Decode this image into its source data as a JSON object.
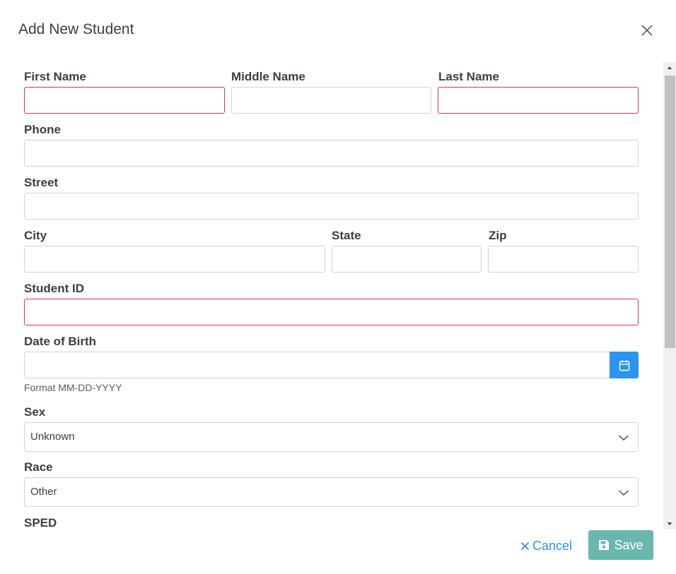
{
  "modal": {
    "title": "Add New Student",
    "close_icon": "close-icon"
  },
  "form": {
    "first_name": {
      "label": "First Name",
      "value": "",
      "invalid": true
    },
    "middle_name": {
      "label": "Middle Name",
      "value": ""
    },
    "last_name": {
      "label": "Last Name",
      "value": "",
      "invalid": true
    },
    "phone": {
      "label": "Phone",
      "value": ""
    },
    "street": {
      "label": "Street",
      "value": ""
    },
    "city": {
      "label": "City",
      "value": ""
    },
    "state": {
      "label": "State",
      "value": ""
    },
    "zip": {
      "label": "Zip",
      "value": ""
    },
    "student_id": {
      "label": "Student ID",
      "value": "",
      "invalid": true
    },
    "date_of_birth": {
      "label": "Date of Birth",
      "value": "",
      "help": "Format MM-DD-YYYY",
      "icon": "calendar-icon"
    },
    "sex": {
      "label": "Sex",
      "selected": "Unknown",
      "icon": "chevron-down-icon"
    },
    "race": {
      "label": "Race",
      "selected": "Other",
      "icon": "chevron-down-icon"
    },
    "sped": {
      "label": "SPED"
    }
  },
  "footer": {
    "cancel_label": "Cancel",
    "cancel_icon": "close-icon",
    "save_label": "Save",
    "save_icon": "floppy-disk-icon"
  },
  "colors": {
    "invalid_border": "#dc3545",
    "accent_blue": "#2b93f0",
    "save_button": "#6ab8ad"
  }
}
